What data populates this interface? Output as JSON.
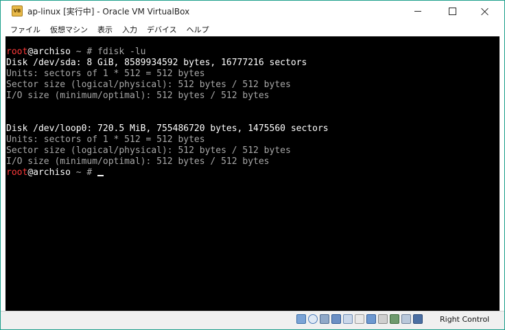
{
  "window": {
    "title": "ap-linux [実行中] - Oracle VM VirtualBox",
    "app_icon": "virtualbox-icon",
    "border_color": "#1a9e8a"
  },
  "menu": {
    "items": [
      "ファイル",
      "仮想マシン",
      "表示",
      "入力",
      "デバイス",
      "ヘルプ"
    ]
  },
  "console": {
    "lines": [
      {
        "type": "prompt",
        "user": "root",
        "host": "@archiso",
        "rest": " ~ # fdisk -lu"
      },
      {
        "type": "bright",
        "text": "Disk /dev/sda: 8 GiB, 8589934592 bytes, 16777216 sectors"
      },
      {
        "type": "normal",
        "text": "Units: sectors of 1 * 512 = 512 bytes"
      },
      {
        "type": "normal",
        "text": "Sector size (logical/physical): 512 bytes / 512 bytes"
      },
      {
        "type": "normal",
        "text": "I/O size (minimum/optimal): 512 bytes / 512 bytes"
      },
      {
        "type": "normal",
        "text": ""
      },
      {
        "type": "normal",
        "text": ""
      },
      {
        "type": "bright",
        "text": "Disk /dev/loop0: 720.5 MiB, 755486720 bytes, 1475560 sectors"
      },
      {
        "type": "normal",
        "text": "Units: sectors of 1 * 512 = 512 bytes"
      },
      {
        "type": "normal",
        "text": "Sector size (logical/physical): 512 bytes / 512 bytes"
      },
      {
        "type": "normal",
        "text": "I/O size (minimum/optimal): 512 bytes / 512 bytes"
      },
      {
        "type": "prompt",
        "user": "root",
        "host": "@archiso",
        "rest": " ~ # ",
        "cursor": true
      }
    ],
    "colors": {
      "background": "#000000",
      "text": "#a8a8a8",
      "bright": "#ffffff",
      "user": "#ff3a3a"
    }
  },
  "statusbar": {
    "icons": [
      "hard-disk-icon",
      "optical-drive-icon",
      "audio-icon",
      "network-icon",
      "usb-icon",
      "shared-folder-icon",
      "display-icon",
      "video-capture-icon",
      "cpu-icon",
      "mouse-integration-icon",
      "keyboard-icon"
    ],
    "host_key": "Right Control"
  }
}
